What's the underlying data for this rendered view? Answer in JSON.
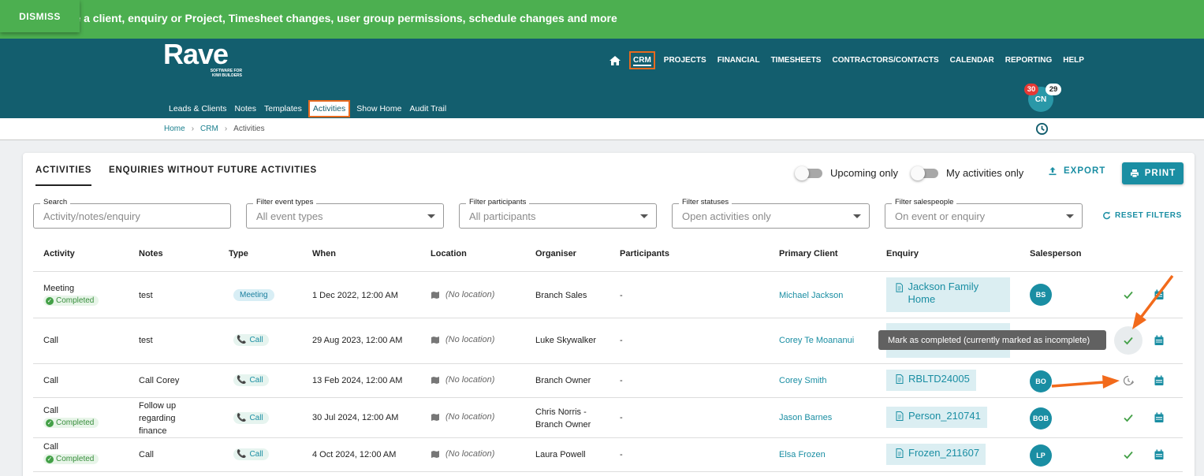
{
  "banner": {
    "dismiss_label": "DISMISS",
    "text": "ete a client, enquiry or Project, Timesheet changes, user group permissions, schedule changes and more"
  },
  "header": {
    "logo_word": "Rave",
    "logo_tagline": "SOFTWARE FOR KIWI BUILDERS",
    "top_nav": [
      "CRM",
      "PROJECTS",
      "FINANCIAL",
      "TIMESHEETS",
      "CONTRACTORS/CONTACTS",
      "CALENDAR",
      "REPORTING",
      "HELP"
    ],
    "sub_nav": [
      "Leads & Clients",
      "Notes",
      "Templates",
      "Activities",
      "Show Home",
      "Audit Trail"
    ],
    "user_initials": "CN",
    "badge_red": "30",
    "badge_white": "29"
  },
  "breadcrumb": {
    "home": "Home",
    "crm": "CRM",
    "current": "Activities"
  },
  "tabs": {
    "activities": "ACTIVITIES",
    "enquiries": "ENQUIRIES WITHOUT FUTURE ACTIVITIES"
  },
  "toggles": {
    "upcoming": "Upcoming only",
    "my_activities": "My activities only"
  },
  "actions": {
    "export": "EXPORT",
    "print": "PRINT",
    "reset": "RESET FILTERS"
  },
  "filters": {
    "search": {
      "label": "Search",
      "placeholder": "Activity/notes/enquiry"
    },
    "event_types": {
      "label": "Filter event types",
      "value": "All event types"
    },
    "participants": {
      "label": "Filter participants",
      "value": "All participants"
    },
    "statuses": {
      "label": "Filter statuses",
      "value": "Open activities only"
    },
    "salespeople": {
      "label": "Filter salespeople",
      "value": "On event or enquiry"
    }
  },
  "columns": [
    "Activity",
    "Notes",
    "Type",
    "When",
    "Location",
    "Organiser",
    "Participants",
    "Primary Client",
    "Enquiry",
    "Salesperson"
  ],
  "rows": [
    {
      "activity": "Meeting",
      "status": "Completed",
      "notes": "test",
      "type": "Meeting",
      "when": "1 Dec 2022, 12:00 AM",
      "location": "(No location)",
      "organiser": "Branch Sales",
      "participants": "-",
      "client": "Michael Jackson",
      "enquiry": "Jackson Family Home",
      "salesperson": "BS"
    },
    {
      "activity": "Call",
      "status": "",
      "notes": "test",
      "type": "Call",
      "when": "29 Aug 2023, 12:00 AM",
      "location": "(No location)",
      "organiser": "Luke Skywalker",
      "participants": "-",
      "client": "Corey Te Moananui",
      "enquiry": "",
      "salesperson": ""
    },
    {
      "activity": "Call",
      "status": "",
      "notes": "Call Corey",
      "type": "Call",
      "when": "13 Feb 2024, 12:00 AM",
      "location": "(No location)",
      "organiser": "Branch Owner",
      "participants": "-",
      "client": "Corey Smith",
      "enquiry": "RBLTD24005",
      "salesperson": "BO"
    },
    {
      "activity": "Call",
      "status": "Completed",
      "notes": "Follow up regarding finance",
      "type": "Call",
      "when": "30 Jul 2024, 12:00 AM",
      "location": "(No location)",
      "organiser": "Chris Norris - Branch Owner",
      "participants": "-",
      "client": "Jason Barnes",
      "enquiry": "Person_210741",
      "salesperson": "BOB"
    },
    {
      "activity": "Call",
      "status": "Completed",
      "notes": "Call",
      "type": "Call",
      "when": "4 Oct 2024, 12:00 AM",
      "location": "(No location)",
      "organiser": "Laura Powell",
      "participants": "-",
      "client": "Elsa Frozen",
      "enquiry": "Frozen_211607",
      "salesperson": "LP"
    }
  ],
  "tooltip": "Mark as completed (currently marked as incomplete)",
  "colors": {
    "banner": "#4caf50",
    "header": "#135e6e",
    "accent": "#1a8ea3",
    "highlight": "#e86a1e"
  },
  "icons": [
    "home-icon",
    "clock-icon",
    "export-icon",
    "printer-icon",
    "refresh-icon",
    "phone-icon",
    "map-icon",
    "document-icon",
    "check-icon",
    "calendar-icon",
    "pending-icon"
  ]
}
